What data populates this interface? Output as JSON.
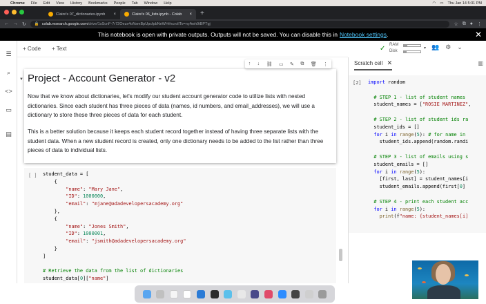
{
  "menubar": {
    "app": "Chrome",
    "items": [
      "File",
      "Edit",
      "View",
      "History",
      "Bookmarks",
      "People",
      "Tab",
      "Window",
      "Help"
    ],
    "clock": "Thu Jan 14  5:31 PM"
  },
  "tabs": [
    {
      "label": "Claire's 07_dictionaries.ipynb"
    },
    {
      "label": "Claire's 06_lists.ipynb - Colab"
    }
  ],
  "address": {
    "host": "colab.research.google.com",
    "path": "/drive/1sScnF-7r72Oezs4oNsmBpUpcfpbNeWH#scrollTo=nyAwh9tBPTgj"
  },
  "infobar": {
    "message": "This notebook is open with private outputs. Outputs will not be saved. You can disable this in",
    "link": "Notebook settings",
    "suffix": "."
  },
  "toolbar": {
    "add_code": "+ Code",
    "add_text": "+ Text"
  },
  "resources": {
    "ram_label": "RAM",
    "disk_label": "Disk",
    "ram_usage": 0.2,
    "disk_usage": 0.15
  },
  "text_cell": {
    "title": "Project - Account Generator - v2",
    "para1": "Now that we know about dictionaries, let's modify our student account generator code to utilize lists with nested dictionaries. Since each student has three pieces of data (names, id numbers, and email_addresses), we will use a dictionary to store these three pieces of data for each student.",
    "para2": "This is a better solution because it keeps each student record together instead of having three separate lists with the student data. When a new student record is created, only one dictionary needs to be added to the list rather than three pieces of data to individual lists."
  },
  "code_cell": {
    "exec_label": "[ ]"
  },
  "scratch": {
    "tab_label": "Scratch cell",
    "exec_label": "[2]"
  },
  "icons": [
    "table-of-contents-icon",
    "search-icon",
    "code-snippets-icon",
    "files-icon",
    "terminal-icon",
    "comment-icon",
    "person-add-icon",
    "settings-icon",
    "chevron-down-icon",
    "close-icon"
  ]
}
